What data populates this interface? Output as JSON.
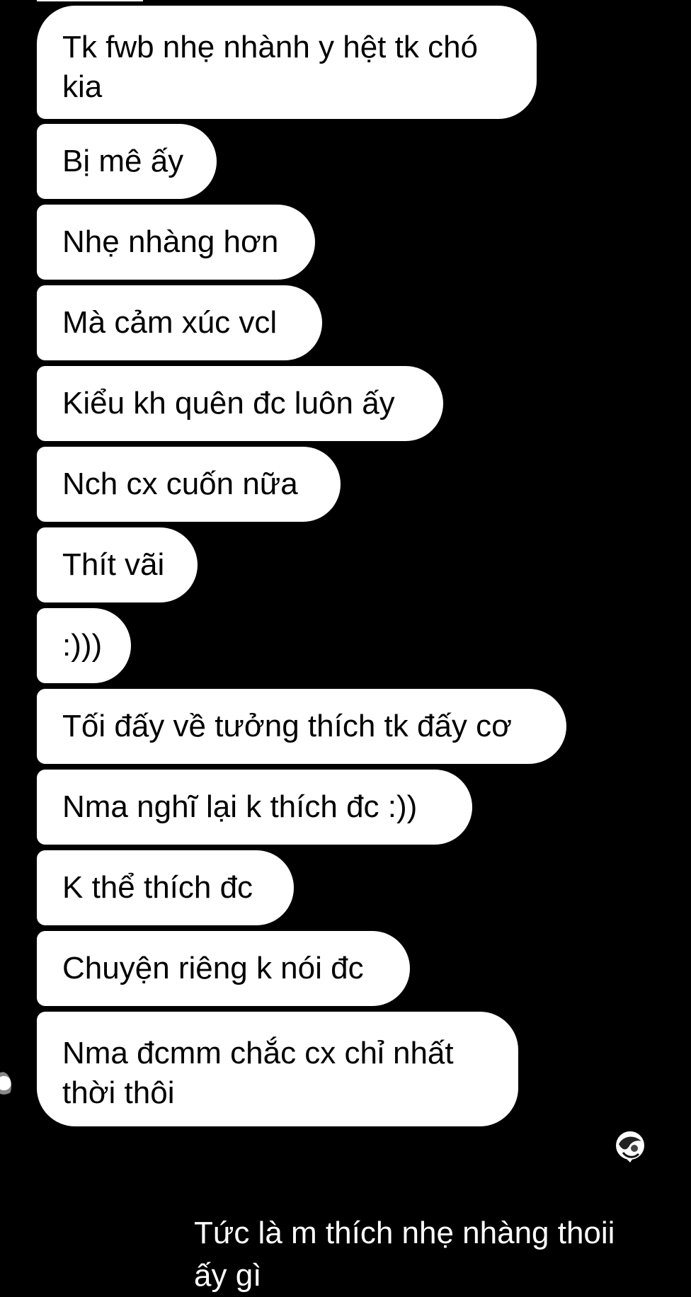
{
  "incoming_messages": [
    "Tk fwb nhẹ nhành y hệt tk chó\nkia",
    "Bị mê ấy",
    "Nhẹ nhàng hơn",
    "Mà cảm xúc vcl",
    "Kiểu kh quên đc luôn ấy",
    "Nch cx cuốn nữa",
    "Thít vãi",
    ":)))",
    "Tối đấy về tưởng thích tk đấy cơ",
    "Nma nghĩ lại k thích đc :))",
    "K thể thích đc",
    "Chuyện riêng k nói đc",
    "Nma đcmm chắc cx chỉ nhất\nthời thôi"
  ],
  "outgoing_message": "Tức là m thích nhẹ nhàng thoii\nấy gì",
  "icons": {
    "sender_avatar": "avatar-icon",
    "seen_indicator": "seen-avatar-icon"
  },
  "colors": {
    "background": "#000000",
    "incoming_bubble": "#ffffff",
    "incoming_text": "#000000",
    "outgoing_text": "#ffffff"
  }
}
